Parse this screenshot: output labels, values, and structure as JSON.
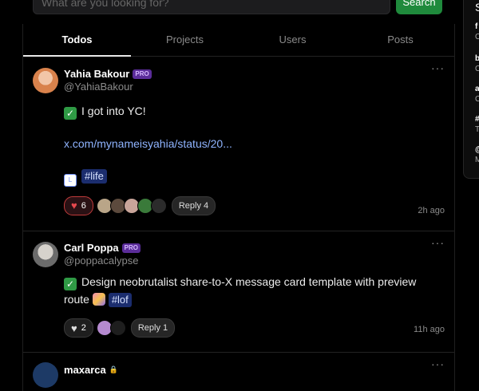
{
  "search": {
    "placeholder": "What are you looking for?",
    "button_label": "Search"
  },
  "tabs": [
    {
      "label": "Todos",
      "active": true
    },
    {
      "label": "Projects",
      "active": false
    },
    {
      "label": "Users",
      "active": false
    },
    {
      "label": "Posts",
      "active": false
    }
  ],
  "posts": [
    {
      "name": "Yahia Bakour",
      "pro_badge": "PRO",
      "handle": "@YahiaBakour",
      "todo": "I got into YC!",
      "link": "x.com/mynameisyahia/status/20...",
      "tag": "#life",
      "tag_icon": "L",
      "likes": "6",
      "liked": true,
      "reply_label": "Reply 4",
      "time": "2h ago"
    },
    {
      "name": "Carl Poppa",
      "pro_badge": "PRO",
      "handle": "@poppacalypse",
      "todo": "Design neobrutalist share-to-X message card template with preview route",
      "tag": "#lof",
      "likes": "2",
      "liked": false,
      "reply_label": "Reply 1",
      "time": "11h ago"
    },
    {
      "name": "maxarca",
      "locked": true
    }
  ],
  "side": {
    "heading": "S",
    "items": [
      {
        "t": "f",
        "s": "C"
      },
      {
        "t": "b",
        "s": "C"
      },
      {
        "t": "a",
        "s": "C"
      },
      {
        "t": "#",
        "s": "T"
      },
      {
        "t": "@",
        "s": "M"
      }
    ]
  },
  "icons": {
    "check": "check-icon",
    "heart": "heart-icon",
    "more": "more-icon",
    "lock": "lock-icon"
  },
  "colors": {
    "accent_green": "#1f8a3c",
    "pro_purple": "#5b2d9a",
    "like_red": "#e5484d",
    "link_blue": "#8fb4ff"
  }
}
